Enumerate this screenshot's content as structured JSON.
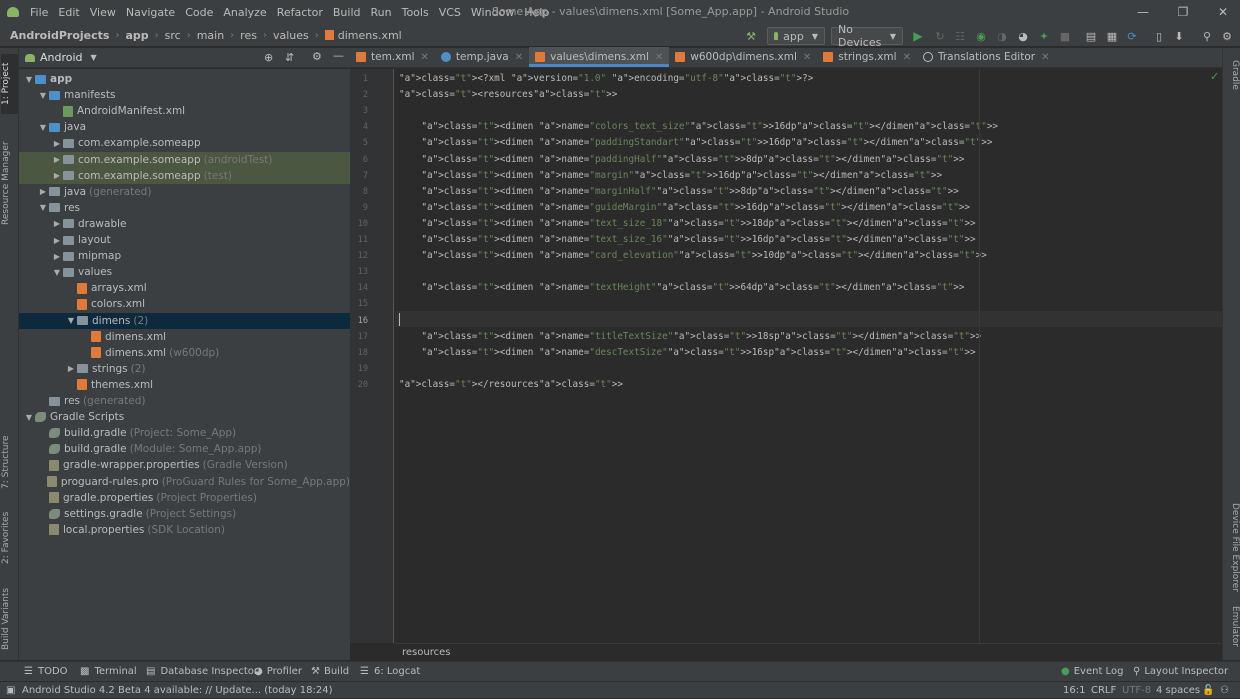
{
  "menu": {
    "items": [
      "File",
      "Edit",
      "View",
      "Navigate",
      "Code",
      "Analyze",
      "Refactor",
      "Build",
      "Run",
      "Tools",
      "VCS",
      "Window",
      "Help"
    ],
    "window_title": "Some App - values\\dimens.xml [Some_App.app] - Android Studio"
  },
  "breadcrumb": [
    "AndroidProjects",
    "app",
    "src",
    "main",
    "res",
    "values",
    "dimens.xml"
  ],
  "toolbar": {
    "run_config": "app",
    "device": "No Devices"
  },
  "project_panel": {
    "view_mode": "Android",
    "tree": [
      {
        "label": "app",
        "suffix": "",
        "kind": "folder-blue",
        "bold": true
      },
      {
        "label": "manifests",
        "suffix": "",
        "kind": "folder-blue"
      },
      {
        "label": "AndroidManifest.xml",
        "suffix": "",
        "kind": "manifest"
      },
      {
        "label": "java",
        "suffix": "",
        "kind": "folder-blue"
      },
      {
        "label": "com.example.someapp",
        "suffix": "",
        "kind": "folder"
      },
      {
        "label": "com.example.someapp",
        "suffix": "(androidTest)",
        "kind": "folder"
      },
      {
        "label": "com.example.someapp",
        "suffix": "(test)",
        "kind": "folder"
      },
      {
        "label": "java",
        "suffix": "(generated)",
        "kind": "folder"
      },
      {
        "label": "res",
        "suffix": "",
        "kind": "folder"
      },
      {
        "label": "drawable",
        "suffix": "",
        "kind": "folder"
      },
      {
        "label": "layout",
        "suffix": "",
        "kind": "folder"
      },
      {
        "label": "mipmap",
        "suffix": "",
        "kind": "folder"
      },
      {
        "label": "values",
        "suffix": "",
        "kind": "folder"
      },
      {
        "label": "arrays.xml",
        "suffix": "",
        "kind": "xml"
      },
      {
        "label": "colors.xml",
        "suffix": "",
        "kind": "xml"
      },
      {
        "label": "dimens",
        "suffix": "(2)",
        "kind": "folder"
      },
      {
        "label": "dimens.xml",
        "suffix": "",
        "kind": "xml"
      },
      {
        "label": "dimens.xml",
        "suffix": "(w600dp)",
        "kind": "xml"
      },
      {
        "label": "strings",
        "suffix": "(2)",
        "kind": "folder"
      },
      {
        "label": "themes.xml",
        "suffix": "",
        "kind": "xml"
      },
      {
        "label": "res",
        "suffix": "(generated)",
        "kind": "folder"
      },
      {
        "label": "Gradle Scripts",
        "suffix": "",
        "kind": "gradle"
      },
      {
        "label": "build.gradle",
        "suffix": "(Project: Some_App)",
        "kind": "gradle"
      },
      {
        "label": "build.gradle",
        "suffix": "(Module: Some_App.app)",
        "kind": "gradle"
      },
      {
        "label": "gradle-wrapper.properties",
        "suffix": "(Gradle Version)",
        "kind": "props"
      },
      {
        "label": "proguard-rules.pro",
        "suffix": "(ProGuard Rules for Some_App.app)",
        "kind": "props"
      },
      {
        "label": "gradle.properties",
        "suffix": "(Project Properties)",
        "kind": "props"
      },
      {
        "label": "settings.gradle",
        "suffix": "(Project Settings)",
        "kind": "gradle"
      },
      {
        "label": "local.properties",
        "suffix": "(SDK Location)",
        "kind": "props"
      }
    ]
  },
  "left_tool_tabs": [
    "1: Project",
    "Resource Manager",
    "7: Structure",
    "2: Favorites",
    "Build Variants"
  ],
  "right_tool_tabs": [
    "Gradle",
    "Device File Explorer",
    "Emulator"
  ],
  "editor_tabs": [
    {
      "label": "tem.xml",
      "icon": "xml",
      "active": false
    },
    {
      "label": "temp.java",
      "icon": "java",
      "active": false
    },
    {
      "label": "values\\dimens.xml",
      "icon": "xml",
      "active": true
    },
    {
      "label": "w600dp\\dimens.xml",
      "icon": "xml",
      "active": false
    },
    {
      "label": "strings.xml",
      "icon": "xml",
      "active": false
    },
    {
      "label": "Translations Editor",
      "icon": "globe",
      "active": false
    }
  ],
  "code": {
    "current_line": 16,
    "lines": [
      "<?xml version=\"1.0\" encoding=\"utf-8\"?>",
      "<resources>",
      "",
      "    <dimen name=\"colors_text_size\">16dp</dimen>",
      "    <dimen name=\"paddingStandart\">16dp</dimen>",
      "    <dimen name=\"paddingHalf\">8dp</dimen>",
      "    <dimen name=\"margin\">16dp</dimen>",
      "    <dimen name=\"marginHalf\">8dp</dimen>",
      "    <dimen name=\"guideMargin\">16dp</dimen>",
      "    <dimen name=\"text_size_18\">18dp</dimen>",
      "    <dimen name=\"text_size_16\">16dp</dimen>",
      "    <dimen name=\"card_elevation\">10dp</dimen>",
      "",
      "    <dimen name=\"textHeight\">64dp</dimen>",
      "",
      "",
      "    <dimen name=\"titleTextSize\">18sp</dimen>",
      "    <dimen name=\"descTextSize\">16sp</dimen>",
      "",
      "</resources>"
    ]
  },
  "editor_breadcrumb": "resources",
  "bottom_tools": {
    "todo": "TODO",
    "terminal": "Terminal",
    "database": "Database Inspector",
    "profiler": "Profiler",
    "build": "Build",
    "logcat": "6: Logcat",
    "event_log": "Event Log",
    "layout_inspector": "Layout Inspector"
  },
  "status": {
    "message": "Android Studio 4.2 Beta 4 available: // Update... (today 18:24)",
    "position": "16:1",
    "line_sep": "CRLF",
    "encoding": "UTF-8",
    "indent": "4 spaces"
  }
}
